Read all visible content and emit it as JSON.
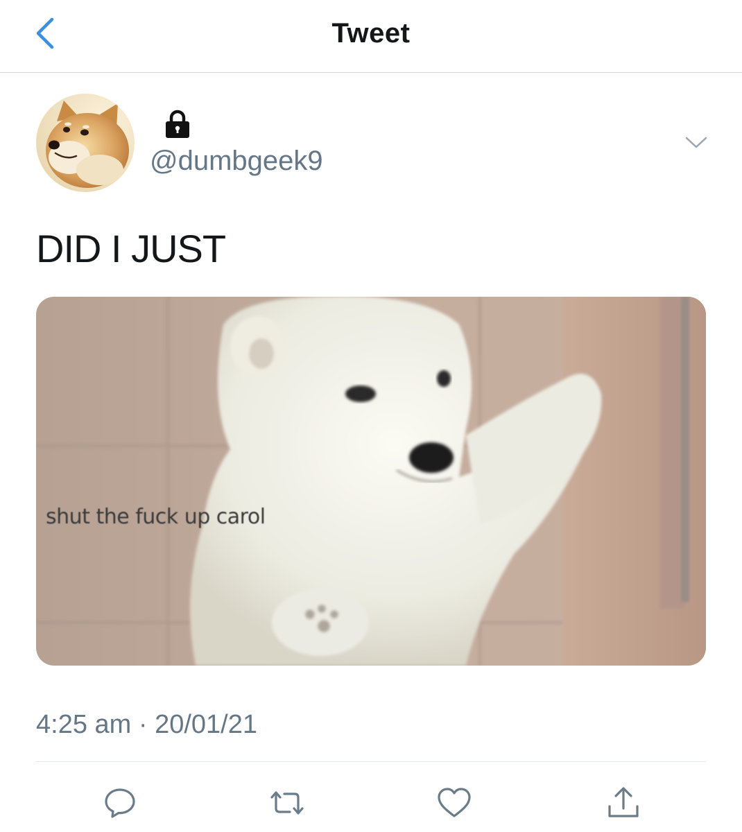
{
  "nav": {
    "title": "Tweet",
    "back_icon": "chevron-left-icon"
  },
  "author": {
    "display_name_icon": "lock-icon",
    "handle": "@dumbgeek9",
    "avatar_icon": "doge-avatar"
  },
  "tweet": {
    "text": "DID I JUST",
    "media": {
      "caption": "shut the fuck up carol",
      "subject": "polar-bear-cub-image"
    },
    "timestamp": "4:25 am · 20/01/21"
  },
  "actions": [
    {
      "icon": "reply-icon"
    },
    {
      "icon": "retweet-icon"
    },
    {
      "icon": "like-icon"
    },
    {
      "icon": "share-icon"
    }
  ],
  "colors": {
    "accent": "#1da1f2",
    "secondary_text": "#657786",
    "divider": "#d4d7da"
  }
}
